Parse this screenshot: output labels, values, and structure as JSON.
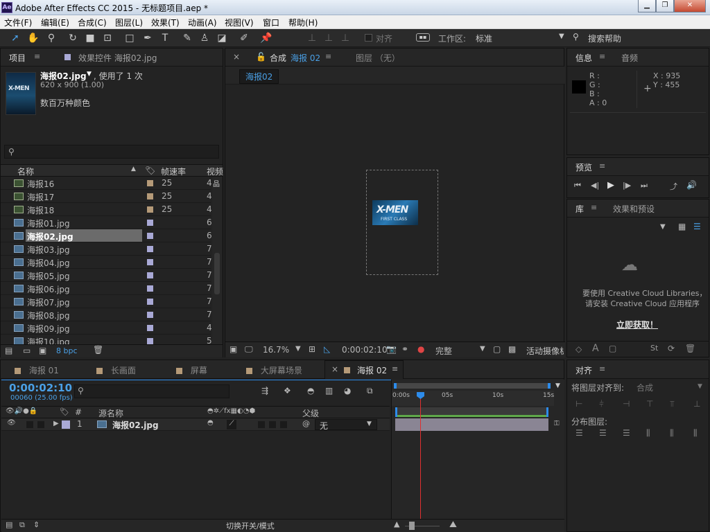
{
  "window": {
    "title": "Adobe After Effects CC 2015 - 无标题项目.aep *",
    "app_icon": "Ae",
    "minimize": "▁",
    "restore": "❐",
    "close": "✕"
  },
  "menu": [
    "文件(F)",
    "编辑(E)",
    "合成(C)",
    "图层(L)",
    "效果(T)",
    "动画(A)",
    "视图(V)",
    "窗口",
    "帮助(H)"
  ],
  "toolbar": {
    "snap_label": "对齐",
    "workspace_label": "工作区:",
    "workspace_value": "标准",
    "search_help": "搜索帮助"
  },
  "project_panel": {
    "tab_project": "项目",
    "tab_effects": "效果控件 海报02.jpg",
    "selected_name": "海报02.jpg",
    "used_text": ", 使用了 1 次",
    "dimensions": "620 x 900 (1.00)",
    "color_info": "数百万种颜色",
    "thumb_text": "X-MEN",
    "col_name": "名称",
    "col_fps": "帧速率",
    "col_video": "视频",
    "bpc": "8 bpc",
    "items": [
      {
        "name": "海报16",
        "type": "comp",
        "label": "#b59a78",
        "fps": "25",
        "video": "4"
      },
      {
        "name": "海报17",
        "type": "comp",
        "label": "#b59a78",
        "fps": "25",
        "video": "4"
      },
      {
        "name": "海报18",
        "type": "comp",
        "label": "#b59a78",
        "fps": "25",
        "video": "4"
      },
      {
        "name": "海报01.jpg",
        "type": "footage",
        "label": "#a9a9d6",
        "fps": "",
        "video": "6"
      },
      {
        "name": "海报02.jpg",
        "type": "footage",
        "label": "#a9a9d6",
        "fps": "",
        "video": "6",
        "selected": true
      },
      {
        "name": "海报03.jpg",
        "type": "footage",
        "label": "#a9a9d6",
        "fps": "",
        "video": "7"
      },
      {
        "name": "海报04.jpg",
        "type": "footage",
        "label": "#a9a9d6",
        "fps": "",
        "video": "7"
      },
      {
        "name": "海报05.jpg",
        "type": "footage",
        "label": "#a9a9d6",
        "fps": "",
        "video": "7"
      },
      {
        "name": "海报06.jpg",
        "type": "footage",
        "label": "#a9a9d6",
        "fps": "",
        "video": "7"
      },
      {
        "name": "海报07.jpg",
        "type": "footage",
        "label": "#a9a9d6",
        "fps": "",
        "video": "7"
      },
      {
        "name": "海报08.jpg",
        "type": "footage",
        "label": "#a9a9d6",
        "fps": "",
        "video": "7"
      },
      {
        "name": "海报09.jpg",
        "type": "footage",
        "label": "#a9a9d6",
        "fps": "",
        "video": "4"
      },
      {
        "name": "海报10.jpg",
        "type": "footage",
        "label": "#a9a9d6",
        "fps": "",
        "video": "5"
      }
    ]
  },
  "comp_panel": {
    "tab_comp_prefix": "合成",
    "tab_comp_name": "海报 02",
    "tab_layer": "图层 （无）",
    "comp_chip": "海报02",
    "thumb_text": "X-MEN",
    "thumb_sub": "FIRST CLASS",
    "zoom": "16.7%",
    "timecode": "0:00:02:10",
    "resolution": "完整",
    "camera": "活动摄像机"
  },
  "info_panel": {
    "tab_info": "信息",
    "tab_audio": "音频",
    "r": "R :",
    "g": "G :",
    "b": "B :",
    "a": "A : 0",
    "x": "X : 935",
    "y": "Y : 455"
  },
  "preview_panel": {
    "tab": "预览"
  },
  "library_panel": {
    "tab_lib": "库",
    "tab_effects": "效果和预设",
    "msg1": "要使用 Creative Cloud Libraries，",
    "msg2": "请安装 Creative Cloud 应用程序",
    "link": "立即获取！"
  },
  "align_panel": {
    "tab": "对齐",
    "align_to_label": "将图层对齐到:",
    "align_to_value": "合成",
    "distribute_label": "分布图层:"
  },
  "timeline": {
    "tabs": [
      {
        "label": "海报 01",
        "active": false
      },
      {
        "label": "长画面",
        "active": false
      },
      {
        "label": "屏幕",
        "active": false
      },
      {
        "label": "大屏幕场景",
        "active": false
      },
      {
        "label": "海报 02",
        "active": true
      }
    ],
    "timecode": "0:00:02:10",
    "frames": "00060 (25.00 fps)",
    "col_num": "#",
    "col_source": "源名称",
    "col_parent": "父级",
    "layer_num": "1",
    "layer_name": "海报02.jpg",
    "layer_parent": "无",
    "ruler": [
      "0:00s",
      "05s",
      "10s",
      "15s"
    ],
    "toggle_label": "切换开关/模式"
  },
  "colors": {
    "accent": "#2d8ceb",
    "playhead": "#e03030",
    "timecode": "#4aa0e6",
    "layer_bar": "#8a8594",
    "work_area": "#5fa84a"
  }
}
